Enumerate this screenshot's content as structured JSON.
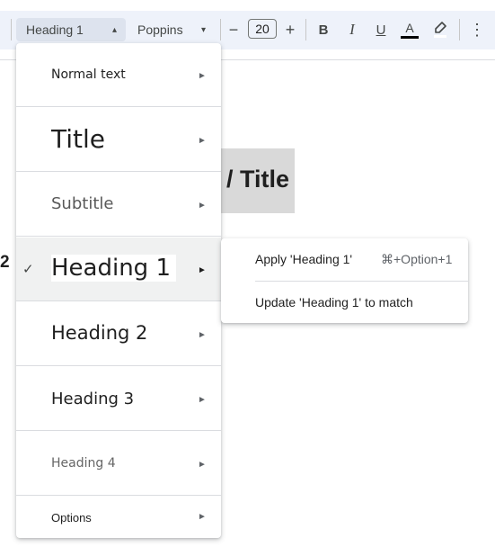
{
  "toolbar": {
    "style_select": {
      "value": "Heading 1",
      "caret": "▴"
    },
    "font_select": {
      "value": "Poppins",
      "caret": "▾"
    },
    "font_size": {
      "decrease": "−",
      "value": "20",
      "increase": "+"
    },
    "bold": "B",
    "italic": "I",
    "underline": "U",
    "text_color": {
      "label": "A",
      "color": "#000000"
    },
    "highlight_icon": "highlighter-icon",
    "more": "⋮"
  },
  "document": {
    "visible_title_fragment": "/ Title",
    "visible_heading_fragment": "2"
  },
  "style_menu": {
    "items": [
      {
        "label": "Normal text",
        "arrow": "►"
      },
      {
        "label": "Title",
        "arrow": "►"
      },
      {
        "label": "Subtitle",
        "arrow": "►"
      },
      {
        "label": "Heading 1",
        "arrow": "►",
        "check": "✓",
        "selected": true
      },
      {
        "label": "Heading 2",
        "arrow": "►"
      },
      {
        "label": "Heading 3",
        "arrow": "►"
      },
      {
        "label": "Heading 4",
        "arrow": "►"
      },
      {
        "label": "Options",
        "arrow": "►"
      }
    ]
  },
  "submenu": {
    "apply_label": "Apply 'Heading 1'",
    "apply_shortcut": "⌘+Option+1",
    "update_label": "Update 'Heading 1' to match"
  }
}
